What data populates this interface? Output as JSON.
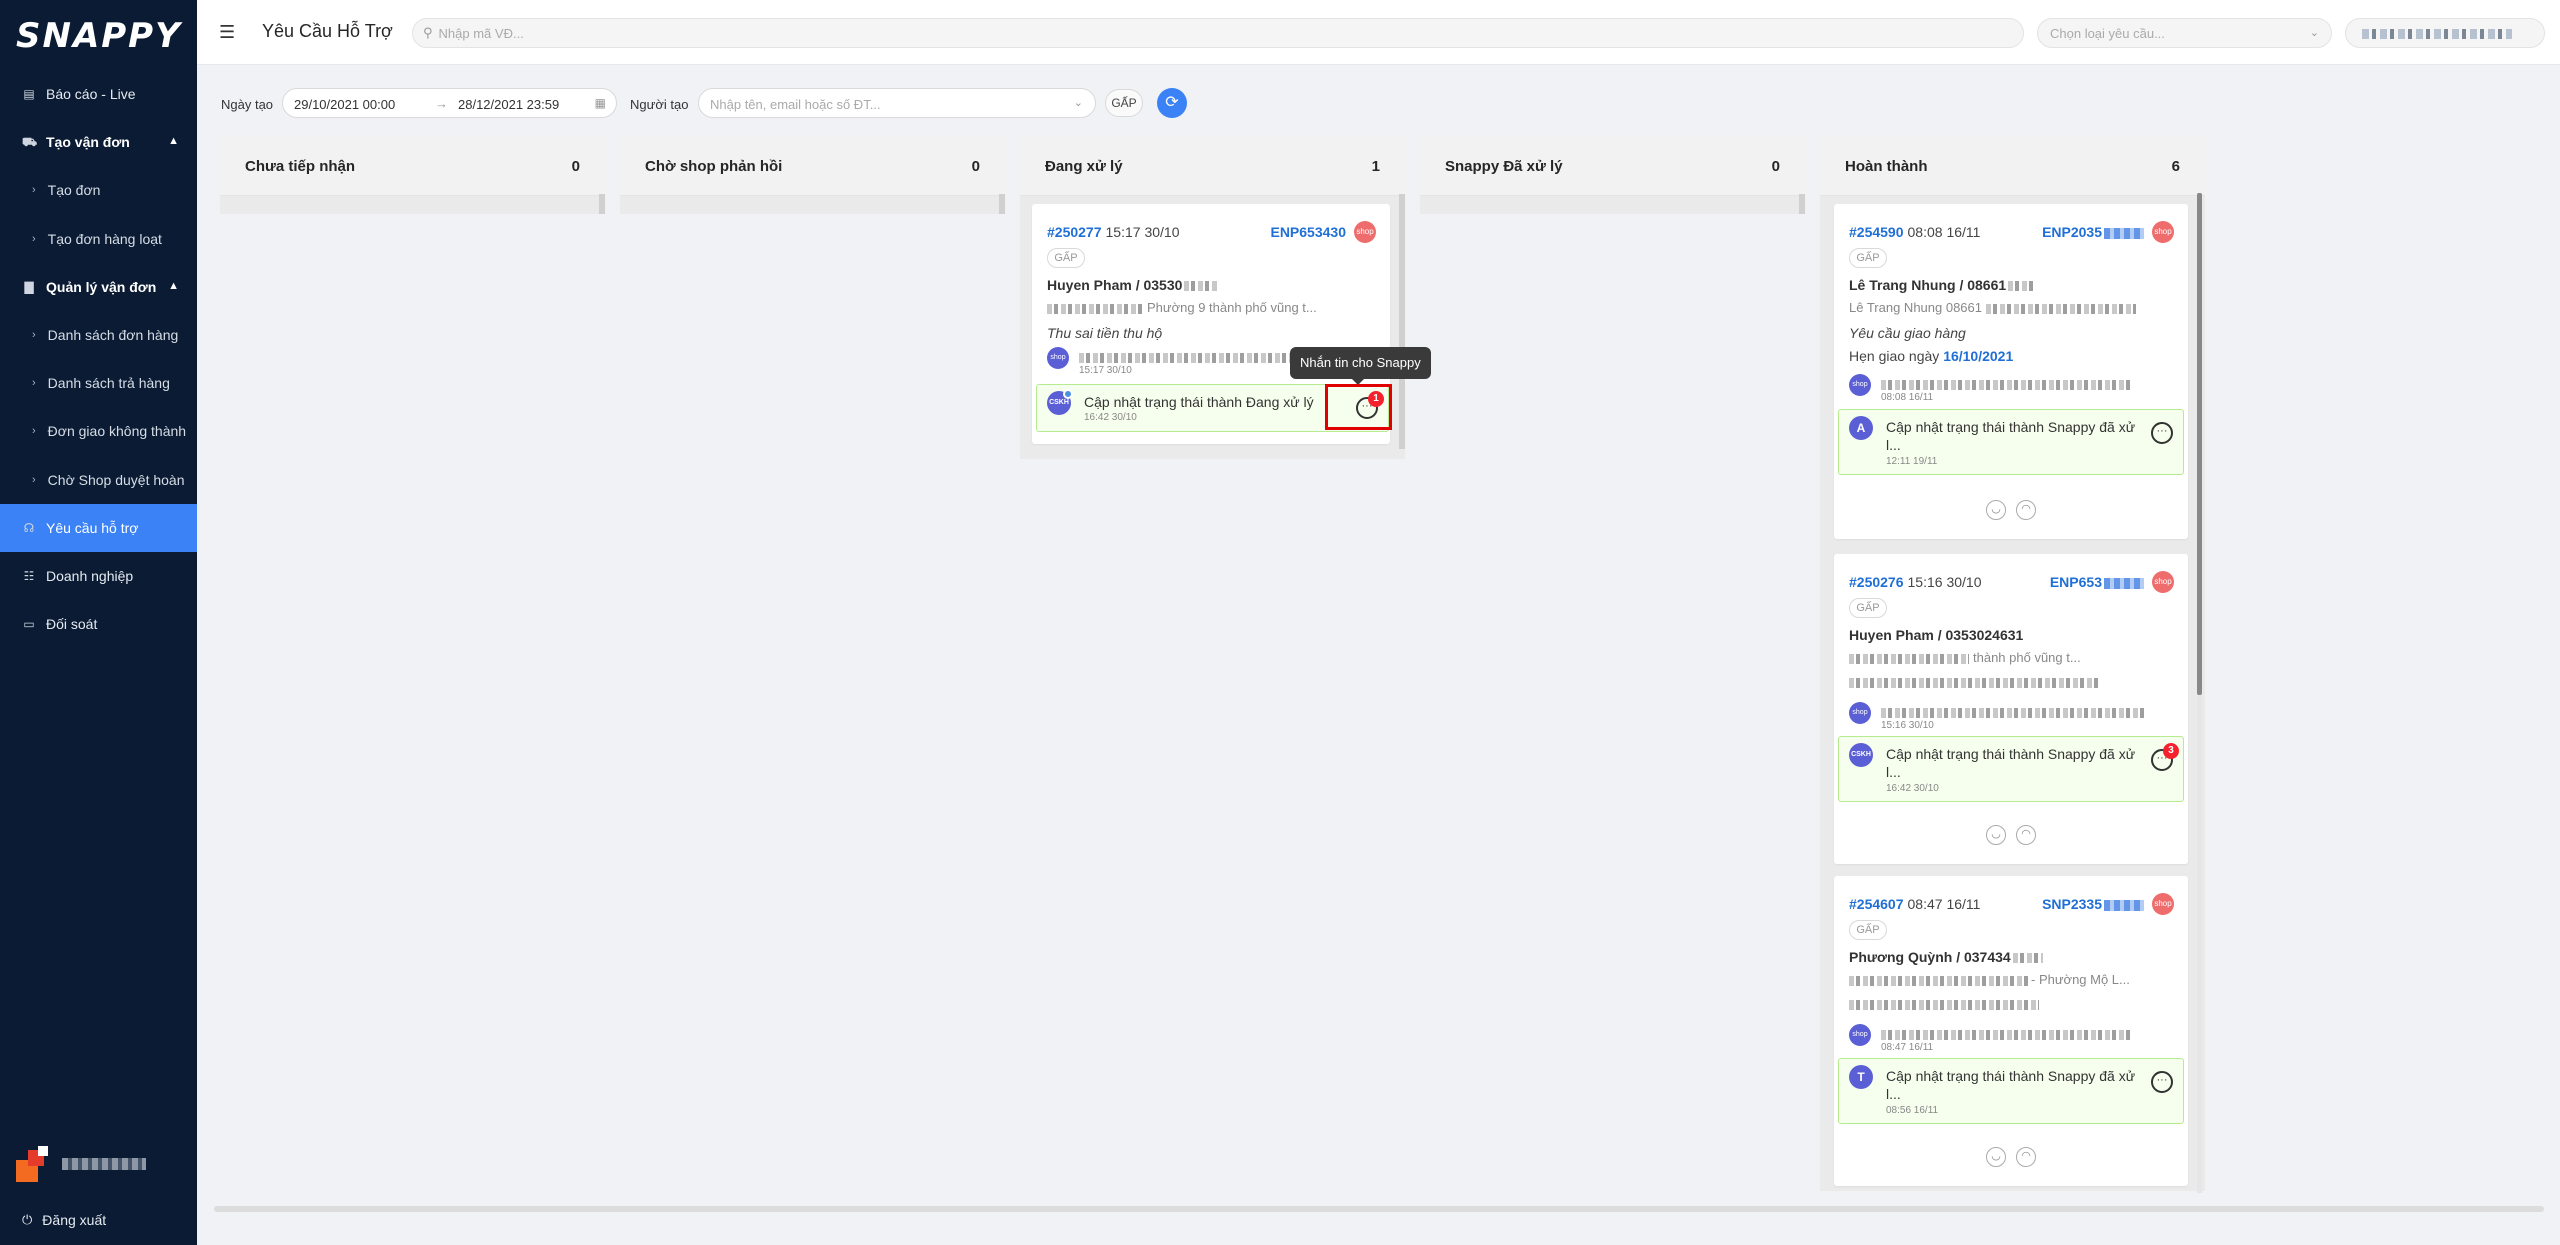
{
  "brand": "SNAPPY",
  "sidebar": {
    "items": [
      {
        "label": "Báo cáo - Live",
        "icon": "report-icon"
      },
      {
        "label": "Tạo vận đơn",
        "icon": "cart-icon"
      },
      {
        "label": "Tạo đơn"
      },
      {
        "label": "Tạo đơn hàng loạt"
      },
      {
        "label": "Quản lý vận đơn",
        "icon": "file-icon"
      },
      {
        "label": "Danh sách đơn hàng"
      },
      {
        "label": "Danh sách trả hàng"
      },
      {
        "label": "Đơn giao không thành"
      },
      {
        "label": "Chờ Shop duyệt hoàn"
      },
      {
        "label": "Yêu cầu hỗ trợ",
        "icon": "headset-icon"
      },
      {
        "label": "Doanh nghiệp",
        "icon": "users-icon"
      },
      {
        "label": "Đối soát",
        "icon": "wallet-icon"
      }
    ],
    "logout": "Đăng xuất"
  },
  "header": {
    "title": "Yêu Cầu Hỗ Trợ",
    "search_placeholder": "Nhập mã VĐ...",
    "type_placeholder": "Chọn loại yêu cầu..."
  },
  "filters": {
    "date_label": "Ngày tạo",
    "date_from": "29/10/2021 00:00",
    "date_to": "28/12/2021 23:59",
    "creator_label": "Người tạo",
    "creator_placeholder": "Nhập tên, email hoặc số ĐT...",
    "urgent": "GẤP"
  },
  "columns": [
    {
      "title": "Chưa tiếp nhận",
      "count": "0"
    },
    {
      "title": "Chờ shop phản hồi",
      "count": "0"
    },
    {
      "title": "Đang xử lý",
      "count": "1"
    },
    {
      "title": "Snappy Đã xử lý",
      "count": "0"
    },
    {
      "title": "Hoàn thành",
      "count": "6"
    }
  ],
  "processing_card": {
    "id": "#250277",
    "time": "15:17 30/10",
    "code": "ENP653430",
    "tag": "GẤP",
    "customer": "Huyen Pham / 03530",
    "address_tail": "Phường 9 thành phố vũng t...",
    "request": "Thu sai tiền thu hộ",
    "note_time": "15:17 30/10",
    "update_text": "Cập nhật trạng thái thành Đang xử lý",
    "update_time": "16:42 30/10",
    "chat_count": "1",
    "tooltip": "Nhắn tin cho Snappy"
  },
  "done_cards": [
    {
      "id": "#254590",
      "time": "08:08 16/11",
      "code": "ENP2035",
      "tag": "GẤP",
      "customer": "Lê Trang Nhung / 08661",
      "address": "Lê Trang Nhung 08661",
      "request": "Yêu cầu giao hàng",
      "extra_label": "Hẹn giao ngày",
      "extra_date": "16/10/2021",
      "note_time": "08:08 16/11",
      "avatar": "A",
      "update_text": "Cập nhật trạng thái thành Snappy đã xử l...",
      "update_time": "12:11 19/11"
    },
    {
      "id": "#250276",
      "time": "15:16 30/10",
      "code": "ENP653",
      "tag": "GẤP",
      "customer": "Huyen Pham / 0353024631",
      "address_tail": "thành phố vũng t...",
      "note_time": "15:16 30/10",
      "avatar": "CSKH",
      "update_text": "Cập nhật trạng thái thành Snappy đã xử l...",
      "update_time": "16:42 30/10",
      "chat_count": "3"
    },
    {
      "id": "#254607",
      "time": "08:47 16/11",
      "code": "SNP2335",
      "tag": "GẤP",
      "customer": "Phương Quỳnh / 037434",
      "address_tail": "- Phường Mộ L...",
      "note_time": "08:47 16/11",
      "avatar": "T",
      "update_text": "Cập nhật trạng thái thành Snappy đã xử l...",
      "update_time": "08:56 16/11"
    }
  ],
  "colors": {
    "sidebar_bg": "#0a1b33",
    "accent": "#3b82f6",
    "link": "#1f6fd6",
    "badge": "#f5222d"
  }
}
